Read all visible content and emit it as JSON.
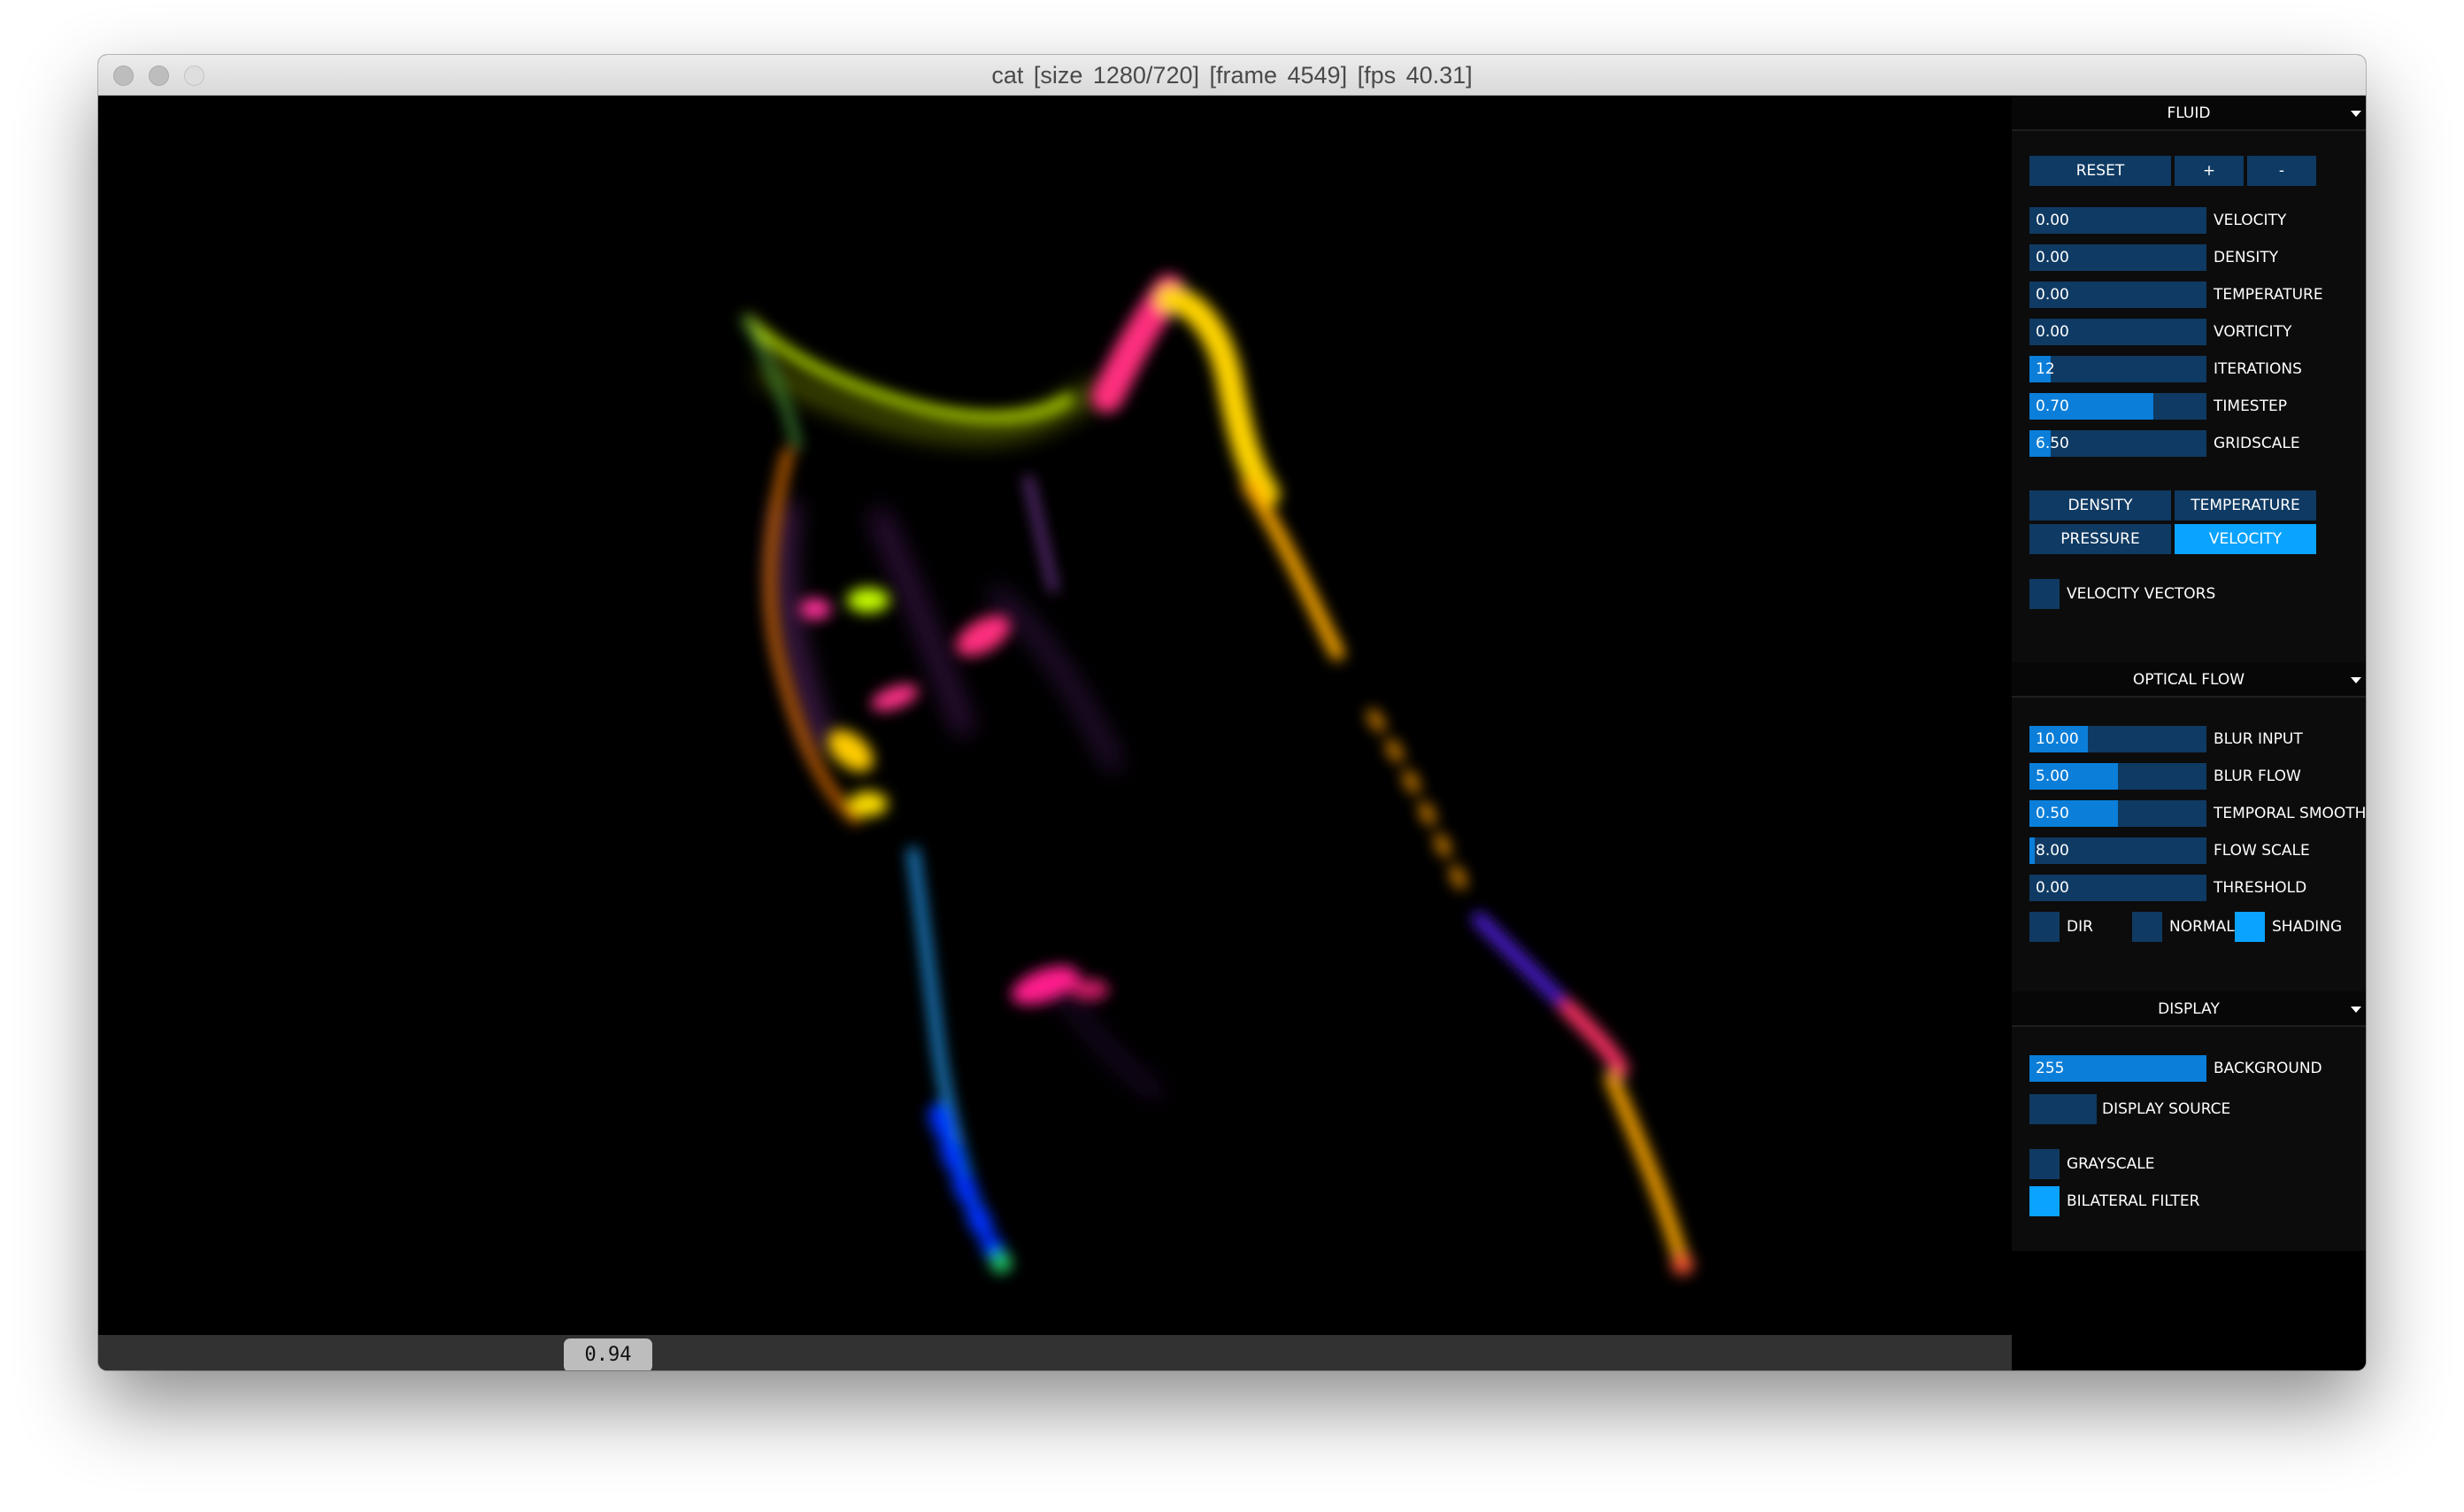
{
  "window": {
    "title": "cat   [size 1280/720]   [frame 4549]   [fps  40.31]"
  },
  "timeline": {
    "position_label": "0.94",
    "position": 0.94
  },
  "panel": {
    "fluid": {
      "header": "FLUID",
      "buttons": {
        "reset": "RESET",
        "plus": "+",
        "minus": "-"
      },
      "sliders": [
        {
          "value": "0.00",
          "label": "VELOCITY",
          "fill": 0.0
        },
        {
          "value": "0.00",
          "label": "DENSITY",
          "fill": 0.0
        },
        {
          "value": "0.00",
          "label": "TEMPERATURE",
          "fill": 0.0
        },
        {
          "value": "0.00",
          "label": "VORTICITY",
          "fill": 0.0
        },
        {
          "value": "12",
          "label": "ITERATIONS",
          "fill": 0.12
        },
        {
          "value": "0.70",
          "label": "TIMESTEP",
          "fill": 0.7
        },
        {
          "value": "6.50",
          "label": "GRIDSCALE",
          "fill": 0.12
        }
      ],
      "views": [
        {
          "label": "DENSITY",
          "active": false
        },
        {
          "label": "TEMPERATURE",
          "active": false
        },
        {
          "label": "PRESSURE",
          "active": false
        },
        {
          "label": "VELOCITY",
          "active": true
        }
      ],
      "velocity_vectors": {
        "label": "VELOCITY VECTORS",
        "checked": false
      }
    },
    "optical_flow": {
      "header": "OPTICAL FLOW",
      "sliders": [
        {
          "value": "10.00",
          "label": "BLUR INPUT",
          "fill": 0.33
        },
        {
          "value": "5.00",
          "label": "BLUR FLOW",
          "fill": 0.5
        },
        {
          "value": "0.50",
          "label": "TEMPORAL SMOOTH",
          "fill": 0.5
        },
        {
          "value": "8.00",
          "label": "FLOW SCALE",
          "fill": 0.03
        },
        {
          "value": "0.00",
          "label": "THRESHOLD",
          "fill": 0.0
        }
      ],
      "checks": [
        {
          "label": "DIR",
          "checked": false
        },
        {
          "label": "NORMAL",
          "checked": false
        },
        {
          "label": "SHADING",
          "checked": true
        }
      ]
    },
    "display": {
      "header": "DISPLAY",
      "background": {
        "value": "255",
        "label": "BACKGROUND",
        "fill": 1.0
      },
      "display_source": {
        "label": "DISPLAY SOURCE",
        "checked": false
      },
      "grayscale": {
        "label": "GRAYSCALE",
        "checked": false
      },
      "bilateral_filter": {
        "label": "BILATERAL FILTER",
        "checked": true
      }
    }
  },
  "colors": {
    "panel_bg": "#0c0c0c",
    "control_bg": "#0f3a63",
    "slider_fill": "#0a7ed9",
    "active": "#0aa3ff"
  }
}
